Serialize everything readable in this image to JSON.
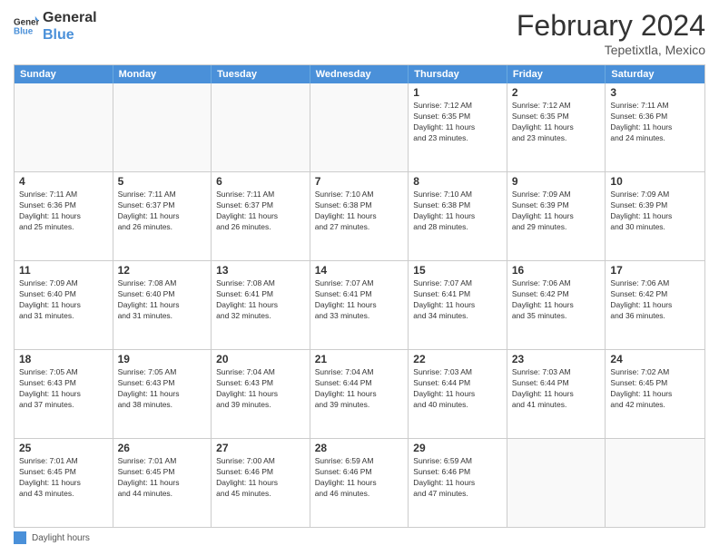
{
  "logo": {
    "line1": "General",
    "line2": "Blue"
  },
  "title": "February 2024",
  "subtitle": "Tepetixtla, Mexico",
  "days_of_week": [
    "Sunday",
    "Monday",
    "Tuesday",
    "Wednesday",
    "Thursday",
    "Friday",
    "Saturday"
  ],
  "weeks": [
    [
      {
        "day": "",
        "info": ""
      },
      {
        "day": "",
        "info": ""
      },
      {
        "day": "",
        "info": ""
      },
      {
        "day": "",
        "info": ""
      },
      {
        "day": "1",
        "info": "Sunrise: 7:12 AM\nSunset: 6:35 PM\nDaylight: 11 hours\nand 23 minutes."
      },
      {
        "day": "2",
        "info": "Sunrise: 7:12 AM\nSunset: 6:35 PM\nDaylight: 11 hours\nand 23 minutes."
      },
      {
        "day": "3",
        "info": "Sunrise: 7:11 AM\nSunset: 6:36 PM\nDaylight: 11 hours\nand 24 minutes."
      }
    ],
    [
      {
        "day": "4",
        "info": "Sunrise: 7:11 AM\nSunset: 6:36 PM\nDaylight: 11 hours\nand 25 minutes."
      },
      {
        "day": "5",
        "info": "Sunrise: 7:11 AM\nSunset: 6:37 PM\nDaylight: 11 hours\nand 26 minutes."
      },
      {
        "day": "6",
        "info": "Sunrise: 7:11 AM\nSunset: 6:37 PM\nDaylight: 11 hours\nand 26 minutes."
      },
      {
        "day": "7",
        "info": "Sunrise: 7:10 AM\nSunset: 6:38 PM\nDaylight: 11 hours\nand 27 minutes."
      },
      {
        "day": "8",
        "info": "Sunrise: 7:10 AM\nSunset: 6:38 PM\nDaylight: 11 hours\nand 28 minutes."
      },
      {
        "day": "9",
        "info": "Sunrise: 7:09 AM\nSunset: 6:39 PM\nDaylight: 11 hours\nand 29 minutes."
      },
      {
        "day": "10",
        "info": "Sunrise: 7:09 AM\nSunset: 6:39 PM\nDaylight: 11 hours\nand 30 minutes."
      }
    ],
    [
      {
        "day": "11",
        "info": "Sunrise: 7:09 AM\nSunset: 6:40 PM\nDaylight: 11 hours\nand 31 minutes."
      },
      {
        "day": "12",
        "info": "Sunrise: 7:08 AM\nSunset: 6:40 PM\nDaylight: 11 hours\nand 31 minutes."
      },
      {
        "day": "13",
        "info": "Sunrise: 7:08 AM\nSunset: 6:41 PM\nDaylight: 11 hours\nand 32 minutes."
      },
      {
        "day": "14",
        "info": "Sunrise: 7:07 AM\nSunset: 6:41 PM\nDaylight: 11 hours\nand 33 minutes."
      },
      {
        "day": "15",
        "info": "Sunrise: 7:07 AM\nSunset: 6:41 PM\nDaylight: 11 hours\nand 34 minutes."
      },
      {
        "day": "16",
        "info": "Sunrise: 7:06 AM\nSunset: 6:42 PM\nDaylight: 11 hours\nand 35 minutes."
      },
      {
        "day": "17",
        "info": "Sunrise: 7:06 AM\nSunset: 6:42 PM\nDaylight: 11 hours\nand 36 minutes."
      }
    ],
    [
      {
        "day": "18",
        "info": "Sunrise: 7:05 AM\nSunset: 6:43 PM\nDaylight: 11 hours\nand 37 minutes."
      },
      {
        "day": "19",
        "info": "Sunrise: 7:05 AM\nSunset: 6:43 PM\nDaylight: 11 hours\nand 38 minutes."
      },
      {
        "day": "20",
        "info": "Sunrise: 7:04 AM\nSunset: 6:43 PM\nDaylight: 11 hours\nand 39 minutes."
      },
      {
        "day": "21",
        "info": "Sunrise: 7:04 AM\nSunset: 6:44 PM\nDaylight: 11 hours\nand 39 minutes."
      },
      {
        "day": "22",
        "info": "Sunrise: 7:03 AM\nSunset: 6:44 PM\nDaylight: 11 hours\nand 40 minutes."
      },
      {
        "day": "23",
        "info": "Sunrise: 7:03 AM\nSunset: 6:44 PM\nDaylight: 11 hours\nand 41 minutes."
      },
      {
        "day": "24",
        "info": "Sunrise: 7:02 AM\nSunset: 6:45 PM\nDaylight: 11 hours\nand 42 minutes."
      }
    ],
    [
      {
        "day": "25",
        "info": "Sunrise: 7:01 AM\nSunset: 6:45 PM\nDaylight: 11 hours\nand 43 minutes."
      },
      {
        "day": "26",
        "info": "Sunrise: 7:01 AM\nSunset: 6:45 PM\nDaylight: 11 hours\nand 44 minutes."
      },
      {
        "day": "27",
        "info": "Sunrise: 7:00 AM\nSunset: 6:46 PM\nDaylight: 11 hours\nand 45 minutes."
      },
      {
        "day": "28",
        "info": "Sunrise: 6:59 AM\nSunset: 6:46 PM\nDaylight: 11 hours\nand 46 minutes."
      },
      {
        "day": "29",
        "info": "Sunrise: 6:59 AM\nSunset: 6:46 PM\nDaylight: 11 hours\nand 47 minutes."
      },
      {
        "day": "",
        "info": ""
      },
      {
        "day": "",
        "info": ""
      }
    ]
  ],
  "legend_label": "Daylight hours",
  "accent_color": "#4a90d9"
}
